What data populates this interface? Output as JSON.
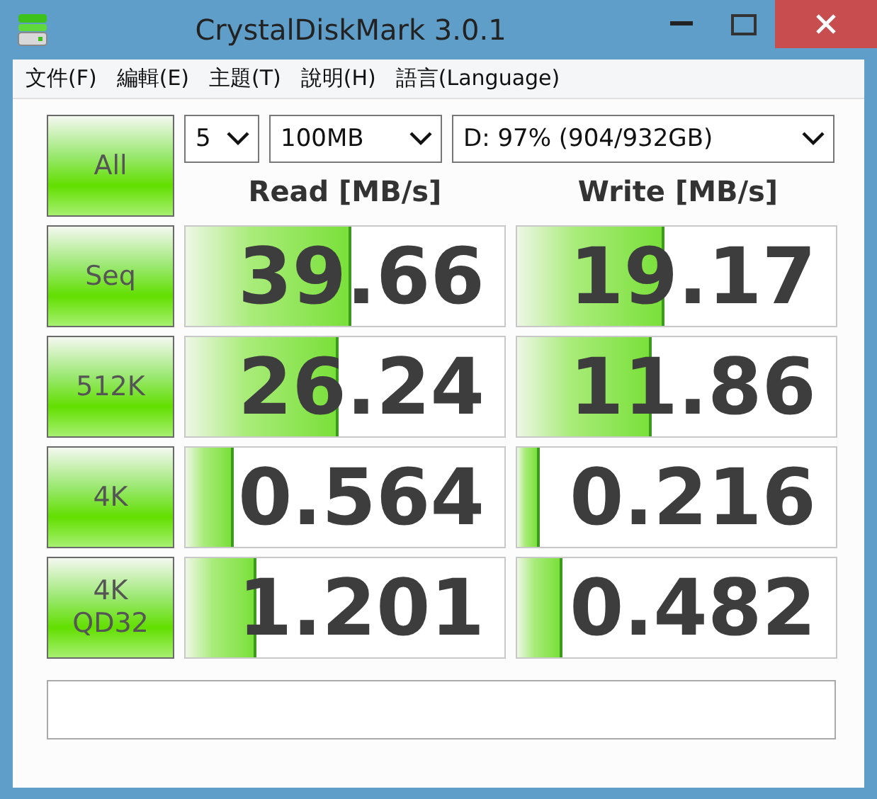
{
  "window": {
    "title": "CrystalDiskMark 3.0.1"
  },
  "menu": [
    "文件(F)",
    "編輯(E)",
    "主題(T)",
    "說明(H)",
    "語言(Language)"
  ],
  "all_button": "All",
  "settings": {
    "count": "5",
    "size": "100MB",
    "drive": "D: 97% (904/932GB)"
  },
  "columns": [
    "Read [MB/s]",
    "Write [MB/s]"
  ],
  "rows": [
    {
      "label": "Seq",
      "read": {
        "value": "39.66",
        "level": 0.52
      },
      "write": {
        "value": "19.17",
        "level": 0.46
      }
    },
    {
      "label": "512K",
      "read": {
        "value": "26.24",
        "level": 0.48
      },
      "write": {
        "value": "11.86",
        "level": 0.42
      }
    },
    {
      "label": "4K",
      "read": {
        "value": "0.564",
        "level": 0.15
      },
      "write": {
        "value": "0.216",
        "level": 0.07
      }
    },
    {
      "label": "4K\nQD32",
      "read": {
        "value": "1.201",
        "level": 0.22
      },
      "write": {
        "value": "0.482",
        "level": 0.14
      }
    }
  ]
}
